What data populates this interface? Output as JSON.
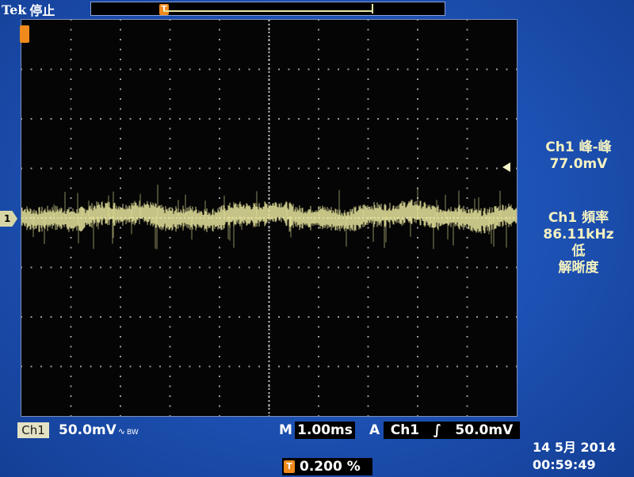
{
  "header": {
    "brand": "Tek",
    "run_state": "停止"
  },
  "channel": {
    "label": "1",
    "box_label": "Ch1",
    "scale": "50.0mV",
    "coupling_symbol": "∿",
    "bandwidth_symbol": "BW",
    "trace_color": "#e7e59c"
  },
  "measurements": {
    "peak_title": "Ch1 峰-峰",
    "peak_value": "77.0mV",
    "freq_title": "Ch1 頻率",
    "freq_value": "86.11kHz",
    "freq_note_line1": "低",
    "freq_note_line2": "解晰度"
  },
  "timebase": {
    "label": "M",
    "value": "1.00ms"
  },
  "trigger": {
    "mode": "A",
    "source": "Ch1",
    "slope_symbol": "∫",
    "level": "50.0mV",
    "marker": "T",
    "position": "0.200 %"
  },
  "timestamp": {
    "date": "14 5月  2014",
    "time": "00:59:49"
  },
  "colors": {
    "background": "#1c50b2",
    "graticule_bg": "#050505",
    "accent_orange": "#f08a1c",
    "readout_yellow": "#f4f2c0"
  }
}
